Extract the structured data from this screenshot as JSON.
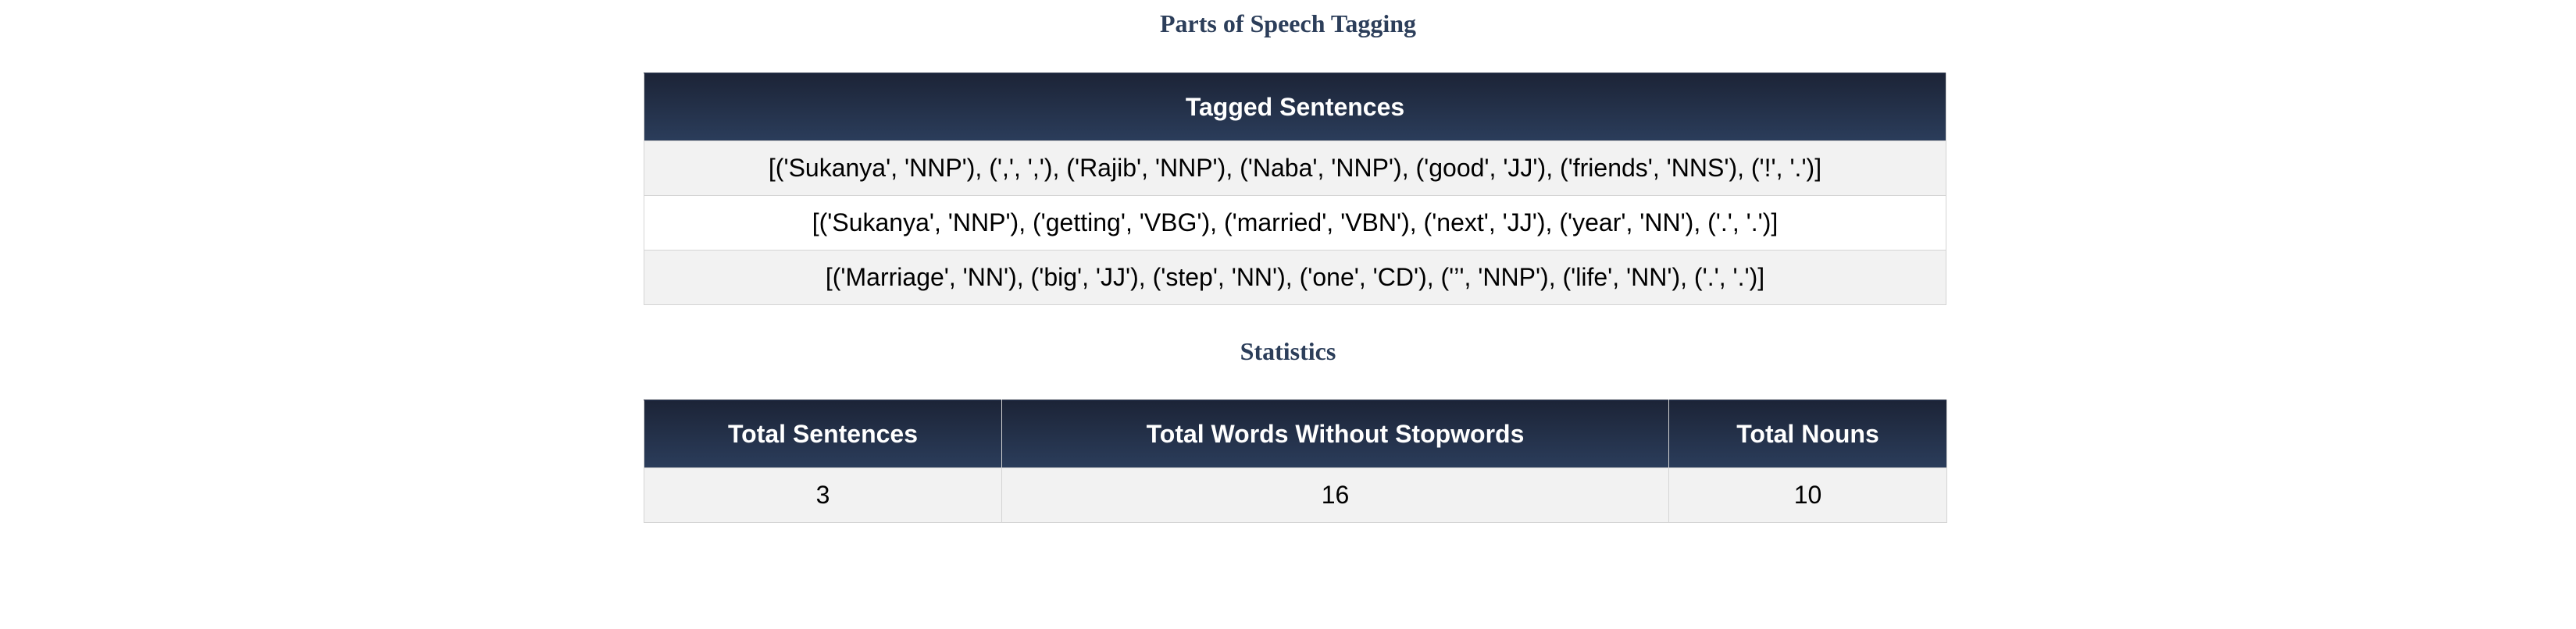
{
  "page": {
    "title": "Parts of Speech Tagging"
  },
  "tagged": {
    "header": "Tagged Sentences",
    "rows": [
      "[('Sukanya', 'NNP'), (',', ','), ('Rajib', 'NNP'), ('Naba', 'NNP'), ('good', 'JJ'), ('friends', 'NNS'), ('!', '.')]",
      "[('Sukanya', 'NNP'), ('getting', 'VBG'), ('married', 'VBN'), ('next', 'JJ'), ('year', 'NN'), ('.', '.')]",
      "[('Marriage', 'NN'), ('big', 'JJ'), ('step', 'NN'), ('one', 'CD'), ('’', 'NNP'), ('life', 'NN'), ('.', '.')]"
    ]
  },
  "stats": {
    "title": "Statistics",
    "headers": [
      "Total Sentences",
      "Total Words Without Stopwords",
      "Total Nouns"
    ],
    "values": [
      "3",
      "16",
      "10"
    ]
  },
  "colors": {
    "heading_text": "#2c3e5a",
    "header_bg_top": "#1c2437",
    "header_bg_bottom": "#2b3d5b",
    "row_alt_bg": "#f2f2f2",
    "border": "#d4d4d4"
  }
}
